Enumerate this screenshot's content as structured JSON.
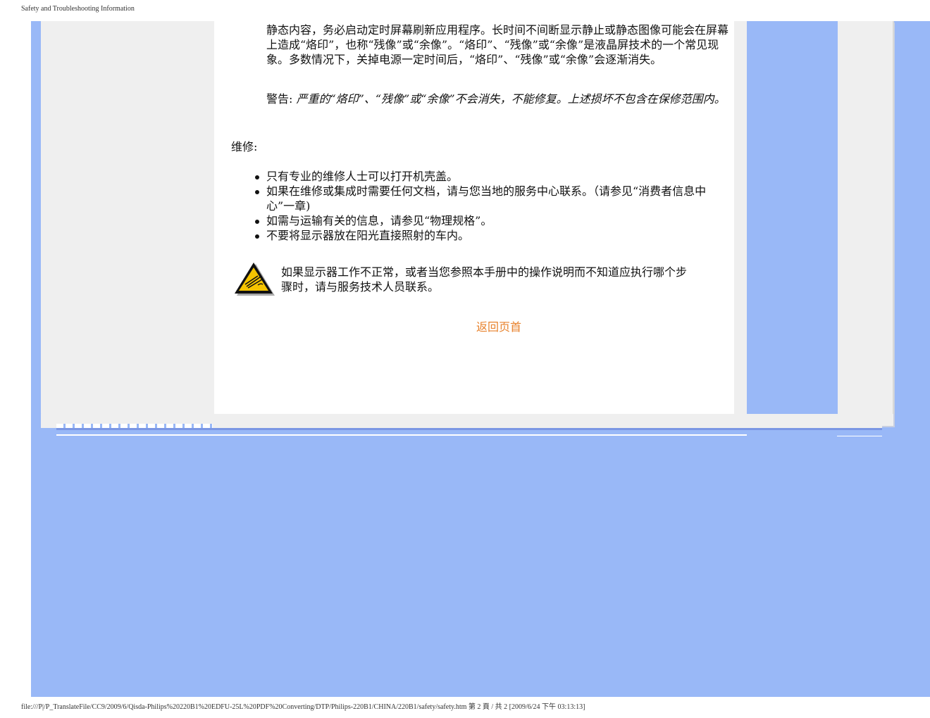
{
  "header": {
    "title": "Safety and Troubleshooting Information"
  },
  "content": {
    "paragraph1": "静态内容，务必启动定时屏幕刷新应用程序。长时间不间断显示静止或静态图像可能会在屏幕上造成“烙印”，也称“残像”或“余像”。“烙印”、“残像”或“余像”是液晶屏技术的一个常见现象。多数情况下，关掉电源一定时间后，“烙印”、“残像”或“余像”会逐渐消失。",
    "warning_label": "警告:",
    "warning_text": "严重的“烙印”、“残像”或“余像”不会消失，不能修复。上述损坏不包含在保修范围内。",
    "section_title": "维修:",
    "bullets": [
      "只有专业的维修人士可以打开机壳盖。",
      "如果在维修或集成时需要任何文档，请与您当地的服务中心联系。（请参见“消费者信息中心”一章)",
      "如需与运输有关的信息，请参见“物理规格”。",
      "不要将显示器放在阳光直接照射的车内。"
    ],
    "notice_text": "如果显示器工作不正常，或者当您参照本手册中的操作说明而不知道应执行哪个步骤时，请与服务技术人员联系。",
    "back_link": "返回页首"
  },
  "footer": {
    "path": "file:///P|/P_TranslateFile/CC9/2009/6/Qisda-Philips%20220B1%20EDFU-25L%20PDF%20Converting/DTP/Philips-220B1/CHINA/220B1/safety/safety.htm 第 2 頁 / 共 2 [2009/6/24 下午 03:13:13]"
  },
  "colors": {
    "background_blue": "#99b8f7",
    "panel_gray": "#efefef",
    "link_orange": "#e8822c"
  }
}
